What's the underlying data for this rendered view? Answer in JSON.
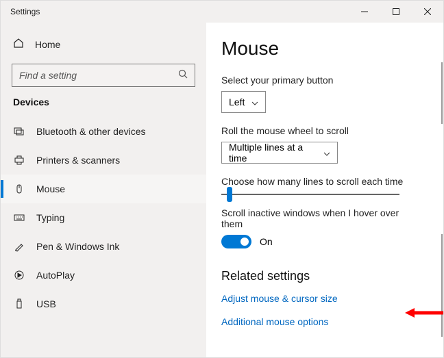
{
  "app_title": "Settings",
  "home_label": "Home",
  "search_placeholder": "Find a setting",
  "category_title": "Devices",
  "nav": {
    "items": [
      {
        "label": "Bluetooth & other devices"
      },
      {
        "label": "Printers & scanners"
      },
      {
        "label": "Mouse"
      },
      {
        "label": "Typing"
      },
      {
        "label": "Pen & Windows Ink"
      },
      {
        "label": "AutoPlay"
      },
      {
        "label": "USB"
      }
    ]
  },
  "page": {
    "title": "Mouse",
    "primary_button_label": "Select your primary button",
    "primary_button_value": "Left",
    "wheel_label": "Roll the mouse wheel to scroll",
    "wheel_value": "Multiple lines at a time",
    "lines_label": "Choose how many lines to scroll each time",
    "scroll_inactive_label": "Scroll inactive windows when I hover over them",
    "toggle_state": "On",
    "related_header": "Related settings",
    "link_adjust": "Adjust mouse & cursor size",
    "link_additional": "Additional mouse options"
  }
}
